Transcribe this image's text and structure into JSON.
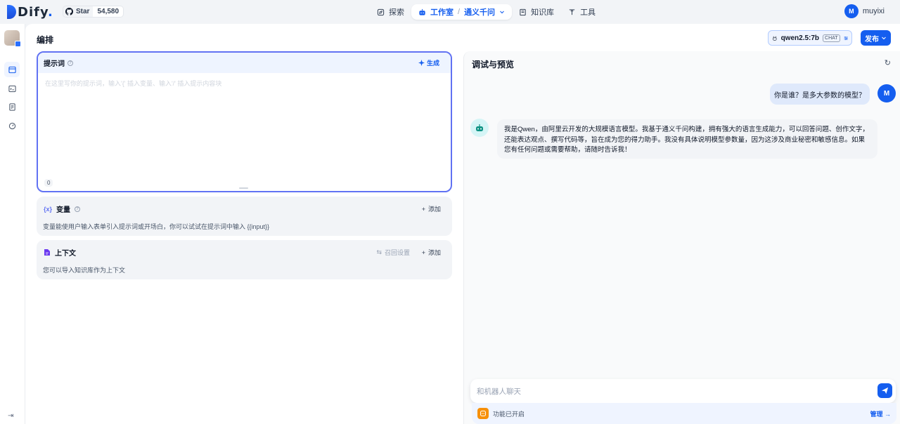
{
  "app": {
    "logo_text": "Dify",
    "logo_dot": "."
  },
  "github": {
    "star_label": "Star",
    "star_count": "54,580"
  },
  "nav": {
    "explore": "探索",
    "studio": "工作室",
    "separator": "/",
    "current_app": "通义千问",
    "knowledge": "知识库",
    "tools": "工具"
  },
  "user": {
    "initial": "M",
    "name": "muyixi"
  },
  "header": {
    "title": "编排",
    "model_name": "qwen2.5:7b",
    "model_mode": "CHAT",
    "publish_label": "发布"
  },
  "prompt": {
    "title": "提示词",
    "generate_label": "生成",
    "placeholder": "在这里写你的提示词，输入'{' 插入变量、输入'/' 插入提示内容块",
    "char_count": "0"
  },
  "variables": {
    "title": "变量",
    "icon_text": "{x}",
    "add_label": "添加",
    "description": "变量能使用户输入表单引入提示词或开场白，你可以试试在提示词中输入 {{input}}"
  },
  "context": {
    "title": "上下文",
    "recall_label": "召回设置",
    "add_label": "添加",
    "description": "您可以导入知识库作为上下文"
  },
  "debug": {
    "title": "调试与预览",
    "user_initial": "M",
    "question": "你是谁？是多大参数的模型？",
    "answer": "我是Qwen，由阿里云开发的大规模语言模型。我基于通义千问构建，拥有强大的语言生成能力，可以回答问题、创作文字，还能表达观点、撰写代码等，旨在成为您的得力助手。我没有具体说明模型参数量，因为这涉及商业秘密和敏感信息。如果您有任何问题或需要帮助，请随时告诉我！",
    "input_placeholder": "和机器人聊天",
    "features_enabled": "功能已开启",
    "manage_label": "管理"
  },
  "colors": {
    "accent": "#155eef",
    "prompt_border": "#6172f3"
  }
}
